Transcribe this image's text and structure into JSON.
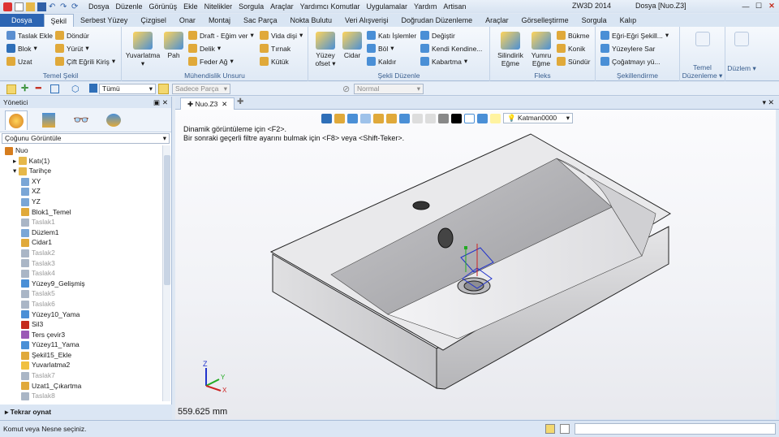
{
  "app": {
    "title": "ZW3D 2014",
    "document_title": "Dosya [Nuo.Z3]"
  },
  "menu": [
    "Dosya",
    "Düzenle",
    "Görünüş",
    "Ekle",
    "Nitelikler",
    "Sorgula",
    "Araçlar",
    "Yardımcı Komutlar",
    "Uygulamalar",
    "Yardım",
    "Artisan"
  ],
  "tabs": [
    "Dosya",
    "Şekil",
    "Serbest Yüzey",
    "Çizgisel",
    "Onar",
    "Montaj",
    "Sac Parça",
    "Nokta Bulutu",
    "Veri Alışverişi",
    "Doğrudan Düzenleme",
    "Araçlar",
    "Görselleştirme",
    "Sorgula",
    "Kalıp"
  ],
  "active_tab": "Şekil",
  "ribbon": {
    "temel_sekil": {
      "label": "Temel Şekil",
      "items": [
        "Taslak Ekle",
        "Blok",
        "Uzat",
        "Döndür",
        "Yürüt",
        "Çift Eğrili Kiriş"
      ]
    },
    "muhendislik": {
      "label": "Mühendislik Unsuru",
      "big": [
        "Yuvarlatma",
        "Pah"
      ],
      "items": [
        "Draft - Eğim ver",
        "Delik",
        "Feder Ağ",
        "Vida dişi",
        "Tırnak",
        "Kütük"
      ]
    },
    "sekli_duzenle": {
      "label": "Şekli Düzenle",
      "big": [
        "Yüzey ofset",
        "Cidar"
      ],
      "items": [
        "Katı İşlemler",
        "Böl",
        "Kaldır",
        "Değiştir",
        "Kendi Kendine...",
        "Kabartma"
      ]
    },
    "fleks": {
      "label": "Fleks",
      "big": [
        "Silindirik Eğme",
        "Yumru Eğme"
      ],
      "items": [
        "Bükme",
        "Konik",
        "Sündür"
      ]
    },
    "sekillendirme": {
      "label": "Şekillendirme",
      "items": [
        "Eğri-Eğri Şekill...",
        "Yüzeylere Sar",
        "Çoğatmayı yü..."
      ]
    },
    "temel_duzenleme": {
      "label": "Temel Düzenleme"
    },
    "duzlem": {
      "label": "Düzlem"
    }
  },
  "toolbar2": {
    "filter_value": "Tümü",
    "part_placeholder": "Sadece Parça",
    "mode_value": "Normal"
  },
  "manager": {
    "title": "Yönetici",
    "view_filter": "Çoğunu Görüntüle",
    "tree": [
      {
        "label": "Nuo",
        "indent": 0,
        "dim": false,
        "icon": "part"
      },
      {
        "label": "Katı(1)",
        "indent": 1,
        "dim": false,
        "icon": "folder"
      },
      {
        "label": "Tarihçe",
        "indent": 1,
        "dim": false,
        "icon": "folder"
      },
      {
        "label": "XY",
        "indent": 2,
        "dim": false,
        "icon": "plane"
      },
      {
        "label": "XZ",
        "indent": 2,
        "dim": false,
        "icon": "plane"
      },
      {
        "label": "YZ",
        "indent": 2,
        "dim": false,
        "icon": "plane"
      },
      {
        "label": "Blok1_Temel",
        "indent": 2,
        "dim": false,
        "icon": "feature"
      },
      {
        "label": "Taslak1",
        "indent": 2,
        "dim": true,
        "icon": "sketch"
      },
      {
        "label": "Düzlem1",
        "indent": 2,
        "dim": false,
        "icon": "plane"
      },
      {
        "label": "Cidar1",
        "indent": 2,
        "dim": false,
        "icon": "feature"
      },
      {
        "label": "Taslak2",
        "indent": 2,
        "dim": true,
        "icon": "sketch"
      },
      {
        "label": "Taslak3",
        "indent": 2,
        "dim": true,
        "icon": "sketch"
      },
      {
        "label": "Taslak4",
        "indent": 2,
        "dim": true,
        "icon": "sketch"
      },
      {
        "label": "Yüzey9_Gelişmiş",
        "indent": 2,
        "dim": false,
        "icon": "surface"
      },
      {
        "label": "Taslak5",
        "indent": 2,
        "dim": true,
        "icon": "sketch"
      },
      {
        "label": "Taslak6",
        "indent": 2,
        "dim": true,
        "icon": "sketch"
      },
      {
        "label": "Yüzey10_Yama",
        "indent": 2,
        "dim": false,
        "icon": "surface"
      },
      {
        "label": "Sil3",
        "indent": 2,
        "dim": false,
        "icon": "delete"
      },
      {
        "label": "Ters çevir3",
        "indent": 2,
        "dim": false,
        "icon": "flip"
      },
      {
        "label": "Yüzey11_Yama",
        "indent": 2,
        "dim": false,
        "icon": "surface"
      },
      {
        "label": "Şekil15_Ekle",
        "indent": 2,
        "dim": false,
        "icon": "feature"
      },
      {
        "label": "Yuvarlatma2",
        "indent": 2,
        "dim": false,
        "icon": "fillet"
      },
      {
        "label": "Taslak7",
        "indent": 2,
        "dim": true,
        "icon": "sketch"
      },
      {
        "label": "Uzat1_Çıkartma",
        "indent": 2,
        "dim": false,
        "icon": "feature"
      },
      {
        "label": "Taslak8",
        "indent": 2,
        "dim": true,
        "icon": "sketch"
      }
    ],
    "repeat_label": "Tekrar oynat"
  },
  "document": {
    "tab": "Nuo.Z3",
    "layer": "Katman0000"
  },
  "viewport": {
    "hint1": "Dinamik görüntüleme için <F2>.",
    "hint2": "Bir sonraki geçerli filtre ayarını bulmak için <F8> veya <Shift-Teker>.",
    "scale": "559.625 mm",
    "axis_x": "X",
    "axis_y": "Y",
    "axis_z": "Z"
  },
  "status": "Komut veya Nesne seçiniz.",
  "colors": {
    "file_tab": "#2c65b3",
    "accent": "#3a5f8f",
    "model": "#d4d4d6"
  }
}
